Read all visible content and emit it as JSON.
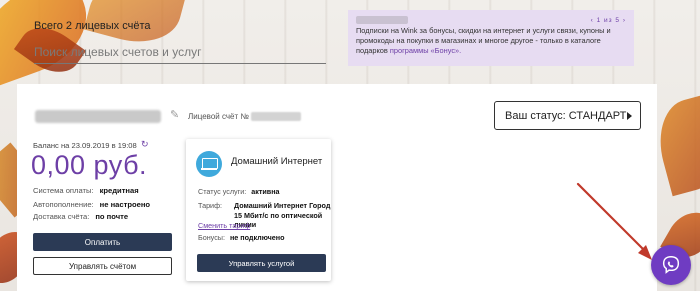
{
  "header": {
    "accounts_count": "Всего 2 лицевых счёта",
    "search_placeholder": "Поиск лицевых счетов и услуг"
  },
  "promo": {
    "pager": "1 из 5",
    "text": "Подписки на Wink за бонусы, скидки на интернет и услуги связи, купоны и промокоды на покупки в магазинах и многое другое - только в каталоге подарков ",
    "link": "программы «Бонус»."
  },
  "account": {
    "account_label": "Лицевой счёт №",
    "status_button": "Ваш статус: СТАНДАРТ",
    "balance_label": "Баланс на 23.09.2019 в 19:08",
    "balance_value": "0,00 руб.",
    "rows": [
      {
        "label": "Система оплаты:",
        "value": "кредитная"
      },
      {
        "label": "Автопополнение:",
        "value": "не настроено"
      },
      {
        "label": "Доставка счёта:",
        "value": "по почте"
      }
    ],
    "pay_button": "Оплатить",
    "manage_account_button": "Управлять счётом"
  },
  "service": {
    "name": "Домашний Интернет",
    "status_label": "Статус услуги:",
    "status_value": "активна",
    "tariff_label": "Тариф:",
    "tariff_value": "Домашний Интернет Город 15 Мбит/с по оптической линии",
    "change_tariff": "Сменить тариф",
    "bonus_label": "Бонусы:",
    "bonus_value": "не подключено",
    "manage_button": "Управлять услугой"
  },
  "colors": {
    "accent": "#6d3fa6",
    "button_dark": "#2b3a55",
    "promo_bg": "#e7dcf2",
    "viber": "#6f3cc2",
    "arrow": "#c0392b"
  }
}
